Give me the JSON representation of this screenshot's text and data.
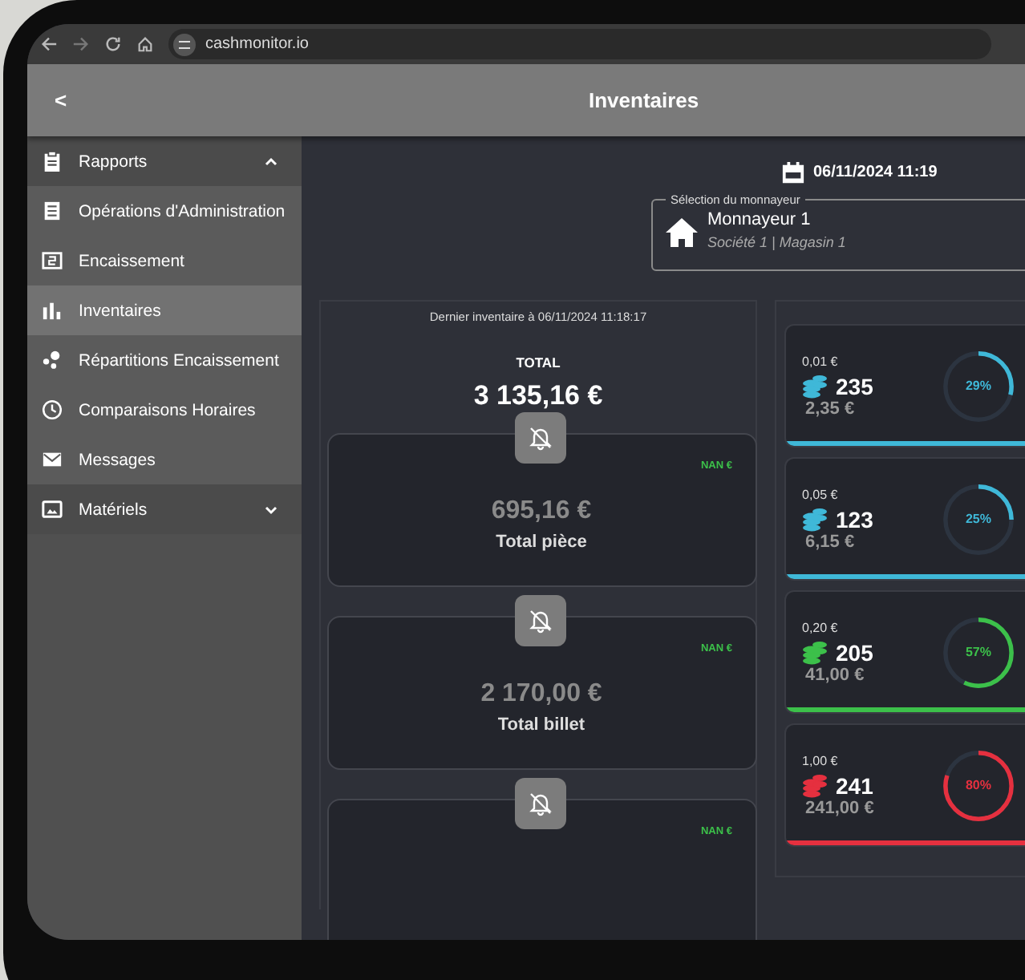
{
  "browser": {
    "url": "cashmonitor.io"
  },
  "header": {
    "back": "<",
    "title": "Inventaires"
  },
  "sidebar": {
    "items": [
      {
        "label": "Rapports",
        "expanded": true,
        "selected": false,
        "children": [
          {
            "label": "Opérations d'Administration",
            "selected": false
          },
          {
            "label": "Encaissement",
            "selected": false
          },
          {
            "label": "Inventaires",
            "selected": true
          },
          {
            "label": "Répartitions Encaissement",
            "selected": false
          },
          {
            "label": "Comparaisons Horaires",
            "selected": false
          },
          {
            "label": "Messages",
            "selected": false
          }
        ]
      },
      {
        "label": "Matériels",
        "expanded": false,
        "selected": false
      }
    ]
  },
  "date": "06/11/2024 11:19",
  "selector": {
    "legend": "Sélection du monnayeur",
    "title": "Monnayeur 1",
    "subtitle": "Société 1 | Magasin 1"
  },
  "summary": {
    "caption": "Dernier inventaire à 06/11/2024 11:18:17",
    "total_label": "TOTAL",
    "total_value": "3 135,16 €",
    "cards": [
      {
        "delta": "NAN €",
        "value": "695,16 €",
        "label": "Total pièce"
      },
      {
        "delta": "NAN €",
        "value": "2 170,00 €",
        "label": "Total billet"
      },
      {
        "delta": "NAN €"
      }
    ]
  },
  "coins": [
    {
      "denomination": "0,01 €",
      "count": "235",
      "amount": "2,35 €",
      "percent": "29%",
      "level": 0.29,
      "color": "#3fb8d8"
    },
    {
      "denomination": "0,05 €",
      "count": "123",
      "amount": "6,15 €",
      "percent": "25%",
      "level": 0.25,
      "color": "#3fb8d8"
    },
    {
      "denomination": "0,20 €",
      "count": "205",
      "amount": "41,00 €",
      "percent": "57%",
      "level": 0.57,
      "color": "#3cc04a"
    },
    {
      "denomination": "1,00 €",
      "count": "241",
      "amount": "241,00 €",
      "percent": "80%",
      "level": 0.8,
      "color": "#e5303f"
    }
  ]
}
